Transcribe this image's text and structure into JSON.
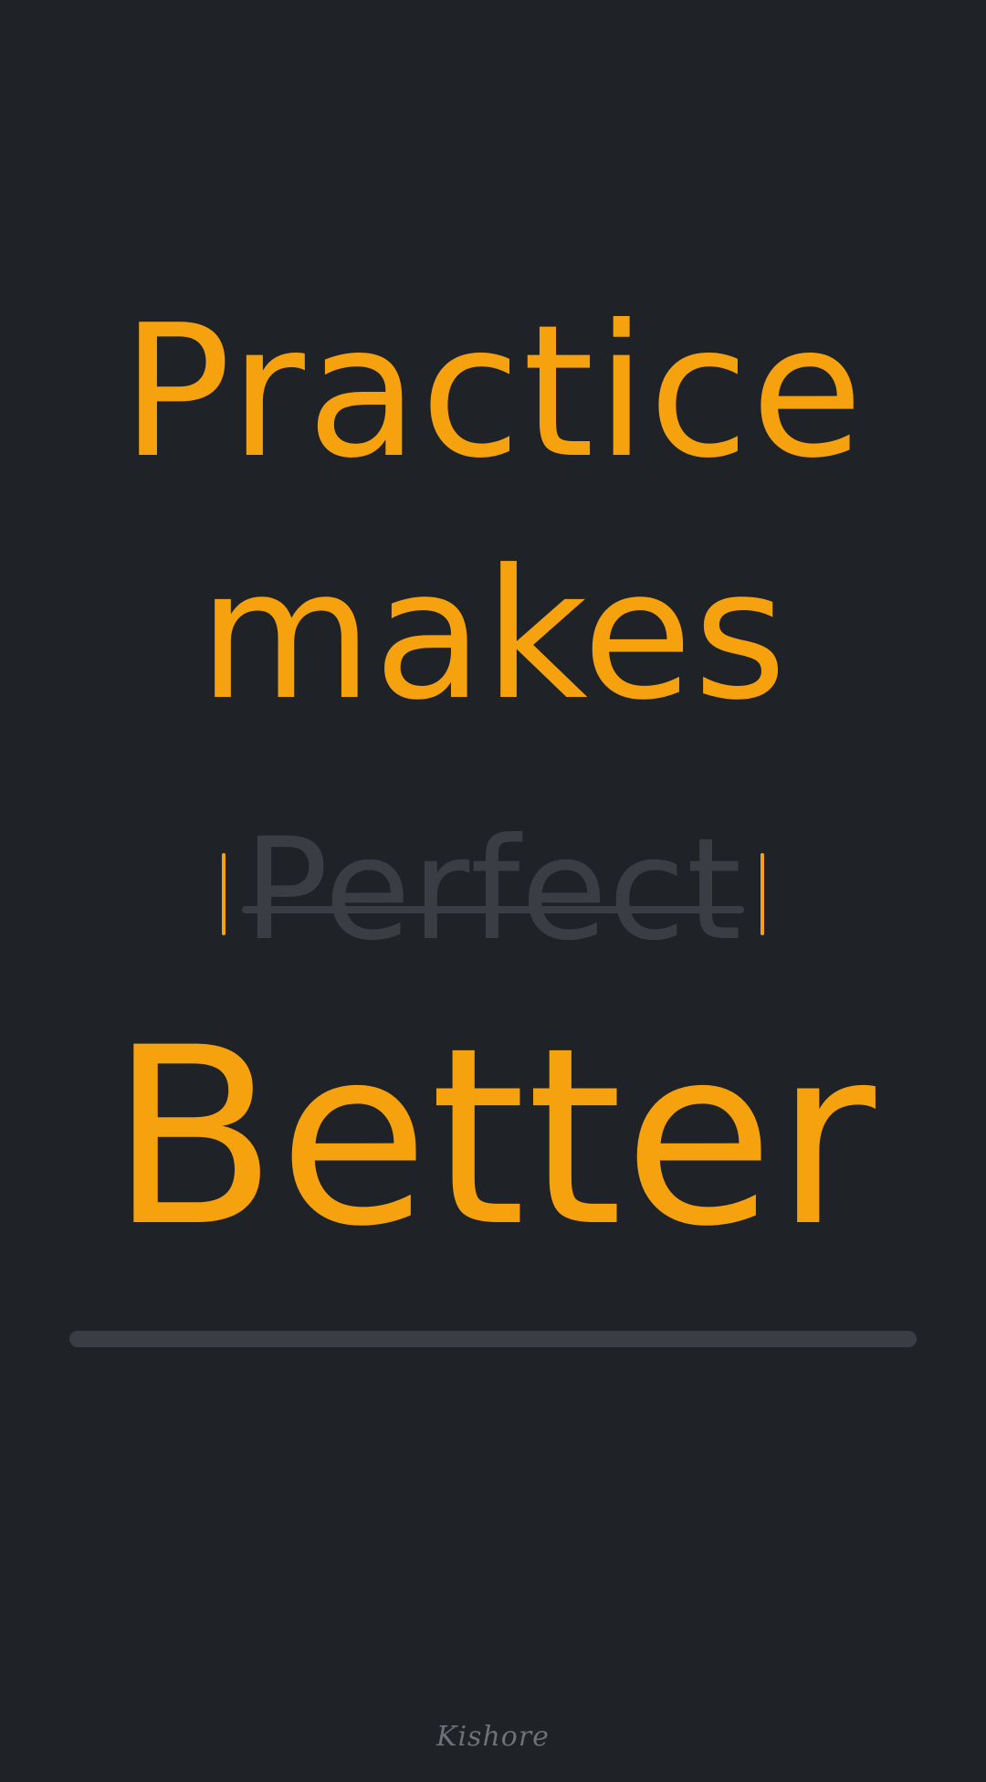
{
  "quote": {
    "line1": "Practice",
    "line2": "makes",
    "struck_word": "Perfect",
    "replacement_word": "Better"
  },
  "signature": "Kishore",
  "colors": {
    "background": "#1f2226",
    "accent": "#f5a20e",
    "muted": "#3a3e44",
    "signature": "#6d7178"
  }
}
